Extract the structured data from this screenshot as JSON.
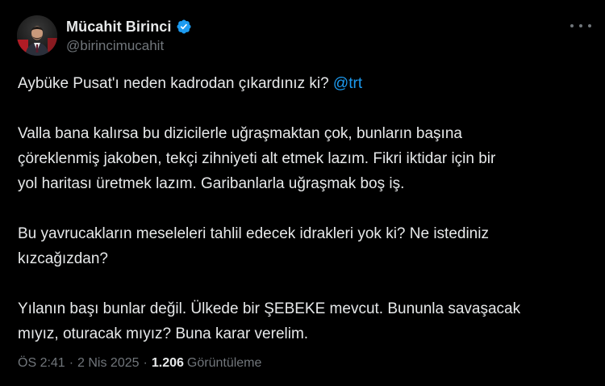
{
  "author": {
    "display_name": "Mücahit Birinci",
    "handle": "@birincimucahit",
    "verified_color": "#1d9bf0",
    "avatar_icon": "profile-photo"
  },
  "tweet": {
    "p1_text": "Aybüke Pusat'ı neden kadrodan çıkardınız ki? ",
    "p1_mention": "@trt",
    "p2_lines": [
      "Valla bana kalırsa bu dizicilerle uğraşmaktan çok, bunların başına",
      "çöreklenmiş jakoben, tekçi zihniyeti alt etmek lazım. Fikri iktidar için bir",
      "yol haritası üretmek lazım. Garibanlarla uğraşmak boş iş."
    ],
    "p3_lines": [
      "Bu yavrucakların meseleleri tahlil edecek idrakleri yok ki? Ne istediniz",
      "kızcağızdan?"
    ],
    "p4_lines": [
      "Yılanın başı bunlar değil. Ülkede bir ŞEBEKE mevcut. Bununla savaşacak",
      "mıyız, oturacak mıyız? Buna karar verelim."
    ]
  },
  "meta": {
    "time": "ÖS 2:41",
    "separator": "·",
    "date": "2 Nis 2025",
    "views_count": "1.206",
    "views_label": "Görüntüleme"
  },
  "colors": {
    "background": "#000000",
    "text": "#e7e9ea",
    "secondary": "#71767b",
    "link": "#1d9bf0"
  }
}
